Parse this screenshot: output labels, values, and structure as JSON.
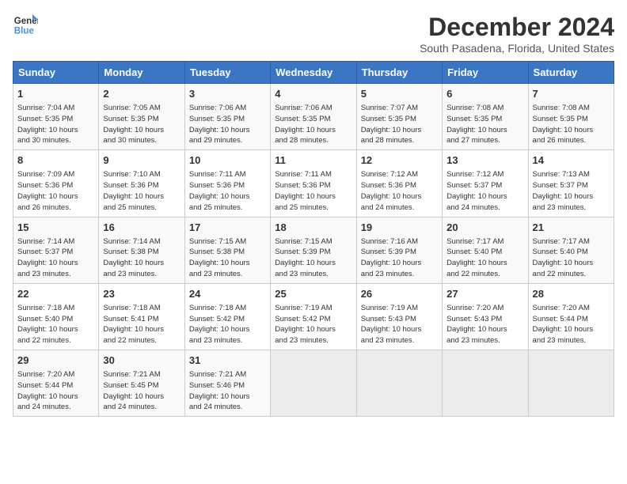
{
  "logo": {
    "line1": "General",
    "line2": "Blue"
  },
  "title": "December 2024",
  "subtitle": "South Pasadena, Florida, United States",
  "weekdays": [
    "Sunday",
    "Monday",
    "Tuesday",
    "Wednesday",
    "Thursday",
    "Friday",
    "Saturday"
  ],
  "weeks": [
    [
      {
        "day": "1",
        "info": "Sunrise: 7:04 AM\nSunset: 5:35 PM\nDaylight: 10 hours\nand 30 minutes."
      },
      {
        "day": "2",
        "info": "Sunrise: 7:05 AM\nSunset: 5:35 PM\nDaylight: 10 hours\nand 30 minutes."
      },
      {
        "day": "3",
        "info": "Sunrise: 7:06 AM\nSunset: 5:35 PM\nDaylight: 10 hours\nand 29 minutes."
      },
      {
        "day": "4",
        "info": "Sunrise: 7:06 AM\nSunset: 5:35 PM\nDaylight: 10 hours\nand 28 minutes."
      },
      {
        "day": "5",
        "info": "Sunrise: 7:07 AM\nSunset: 5:35 PM\nDaylight: 10 hours\nand 28 minutes."
      },
      {
        "day": "6",
        "info": "Sunrise: 7:08 AM\nSunset: 5:35 PM\nDaylight: 10 hours\nand 27 minutes."
      },
      {
        "day": "7",
        "info": "Sunrise: 7:08 AM\nSunset: 5:35 PM\nDaylight: 10 hours\nand 26 minutes."
      }
    ],
    [
      {
        "day": "8",
        "info": "Sunrise: 7:09 AM\nSunset: 5:36 PM\nDaylight: 10 hours\nand 26 minutes."
      },
      {
        "day": "9",
        "info": "Sunrise: 7:10 AM\nSunset: 5:36 PM\nDaylight: 10 hours\nand 25 minutes."
      },
      {
        "day": "10",
        "info": "Sunrise: 7:11 AM\nSunset: 5:36 PM\nDaylight: 10 hours\nand 25 minutes."
      },
      {
        "day": "11",
        "info": "Sunrise: 7:11 AM\nSunset: 5:36 PM\nDaylight: 10 hours\nand 25 minutes."
      },
      {
        "day": "12",
        "info": "Sunrise: 7:12 AM\nSunset: 5:36 PM\nDaylight: 10 hours\nand 24 minutes."
      },
      {
        "day": "13",
        "info": "Sunrise: 7:12 AM\nSunset: 5:37 PM\nDaylight: 10 hours\nand 24 minutes."
      },
      {
        "day": "14",
        "info": "Sunrise: 7:13 AM\nSunset: 5:37 PM\nDaylight: 10 hours\nand 23 minutes."
      }
    ],
    [
      {
        "day": "15",
        "info": "Sunrise: 7:14 AM\nSunset: 5:37 PM\nDaylight: 10 hours\nand 23 minutes."
      },
      {
        "day": "16",
        "info": "Sunrise: 7:14 AM\nSunset: 5:38 PM\nDaylight: 10 hours\nand 23 minutes."
      },
      {
        "day": "17",
        "info": "Sunrise: 7:15 AM\nSunset: 5:38 PM\nDaylight: 10 hours\nand 23 minutes."
      },
      {
        "day": "18",
        "info": "Sunrise: 7:15 AM\nSunset: 5:39 PM\nDaylight: 10 hours\nand 23 minutes."
      },
      {
        "day": "19",
        "info": "Sunrise: 7:16 AM\nSunset: 5:39 PM\nDaylight: 10 hours\nand 23 minutes."
      },
      {
        "day": "20",
        "info": "Sunrise: 7:17 AM\nSunset: 5:40 PM\nDaylight: 10 hours\nand 22 minutes."
      },
      {
        "day": "21",
        "info": "Sunrise: 7:17 AM\nSunset: 5:40 PM\nDaylight: 10 hours\nand 22 minutes."
      }
    ],
    [
      {
        "day": "22",
        "info": "Sunrise: 7:18 AM\nSunset: 5:40 PM\nDaylight: 10 hours\nand 22 minutes."
      },
      {
        "day": "23",
        "info": "Sunrise: 7:18 AM\nSunset: 5:41 PM\nDaylight: 10 hours\nand 22 minutes."
      },
      {
        "day": "24",
        "info": "Sunrise: 7:18 AM\nSunset: 5:42 PM\nDaylight: 10 hours\nand 23 minutes."
      },
      {
        "day": "25",
        "info": "Sunrise: 7:19 AM\nSunset: 5:42 PM\nDaylight: 10 hours\nand 23 minutes."
      },
      {
        "day": "26",
        "info": "Sunrise: 7:19 AM\nSunset: 5:43 PM\nDaylight: 10 hours\nand 23 minutes."
      },
      {
        "day": "27",
        "info": "Sunrise: 7:20 AM\nSunset: 5:43 PM\nDaylight: 10 hours\nand 23 minutes."
      },
      {
        "day": "28",
        "info": "Sunrise: 7:20 AM\nSunset: 5:44 PM\nDaylight: 10 hours\nand 23 minutes."
      }
    ],
    [
      {
        "day": "29",
        "info": "Sunrise: 7:20 AM\nSunset: 5:44 PM\nDaylight: 10 hours\nand 24 minutes."
      },
      {
        "day": "30",
        "info": "Sunrise: 7:21 AM\nSunset: 5:45 PM\nDaylight: 10 hours\nand 24 minutes."
      },
      {
        "day": "31",
        "info": "Sunrise: 7:21 AM\nSunset: 5:46 PM\nDaylight: 10 hours\nand 24 minutes."
      },
      {
        "day": "",
        "info": ""
      },
      {
        "day": "",
        "info": ""
      },
      {
        "day": "",
        "info": ""
      },
      {
        "day": "",
        "info": ""
      }
    ]
  ]
}
